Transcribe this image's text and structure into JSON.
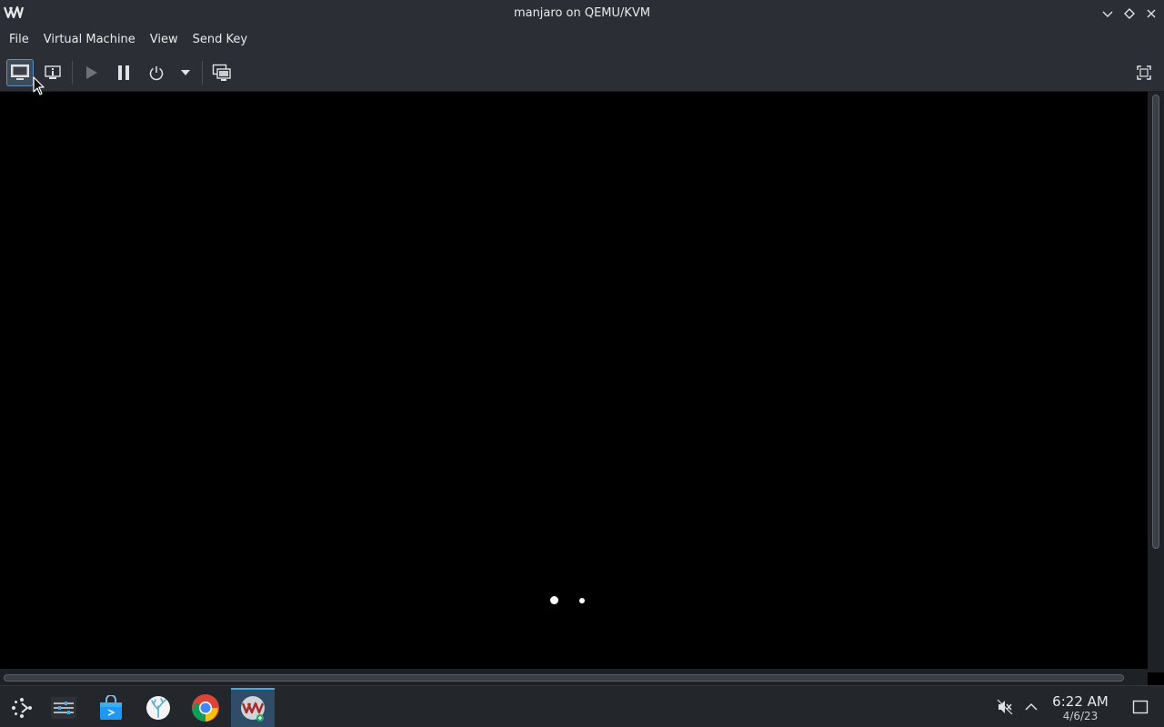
{
  "window": {
    "title": "manjaro on QEMU/KVM",
    "logo": "VM"
  },
  "menu": {
    "items": [
      "File",
      "Virtual Machine",
      "View",
      "Send Key"
    ]
  },
  "toolbar": {
    "buttons": [
      {
        "icon": "monitor-icon",
        "active": true
      },
      {
        "icon": "info-icon"
      },
      {
        "icon": "play-icon"
      },
      {
        "icon": "pause-icon"
      },
      {
        "icon": "power-icon"
      },
      {
        "icon": "chevron-down-icon"
      },
      {
        "icon": "screenshot-icon"
      },
      {
        "icon": "fullscreen-icon"
      }
    ]
  },
  "display": {
    "loading_dots": 2
  },
  "taskbar": {
    "apps": [
      {
        "icon": "app-launcher-icon"
      },
      {
        "icon": "settings-icon"
      },
      {
        "icon": "software-store-icon"
      },
      {
        "icon": "coral-app-icon"
      },
      {
        "icon": "chrome-icon"
      },
      {
        "icon": "virt-manager-icon",
        "active": true
      }
    ],
    "tray": {
      "icons": [
        "volume-muted-icon",
        "chevron-up-icon",
        "show-desktop-icon"
      ]
    },
    "clock": {
      "time": "6:22 AM",
      "date": "4/6/23"
    }
  },
  "colors": {
    "chrome_bg": "#2b2f35",
    "accent": "#3daee9",
    "display_bg": "#000000"
  }
}
